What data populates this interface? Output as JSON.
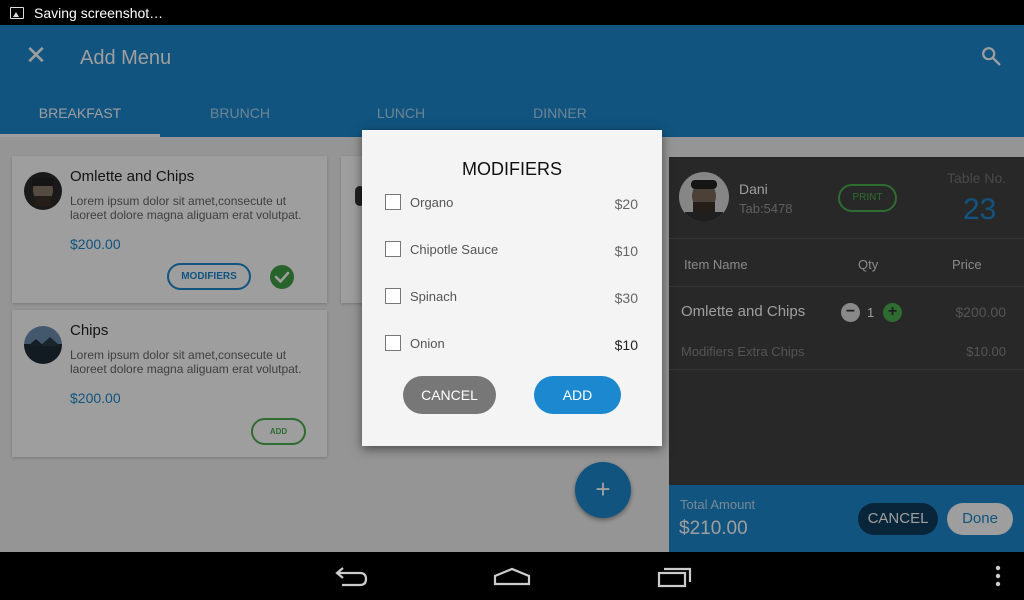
{
  "status_bar": {
    "notification_text": "Saving screenshot…",
    "icon": "image-icon"
  },
  "app_bar": {
    "title": "Add Menu",
    "close_icon": "close-icon",
    "search_icon": "search-icon"
  },
  "tabs": [
    {
      "label": "BREAKFAST",
      "active": true
    },
    {
      "label": "BRUNCH",
      "active": false
    },
    {
      "label": "LUNCH",
      "active": false
    },
    {
      "label": "DINNER",
      "active": false
    }
  ],
  "menu_items": [
    {
      "name": "Omlette and Chips",
      "description": "Lorem ipsum dolor sit amet,consecute ut laoreet dolore magna aliguam erat volutpat.",
      "price": "$200.00",
      "action_label": "MODIFIERS",
      "selected": true
    },
    {
      "name": "Chips",
      "description": "Lorem ipsum dolor sit amet,consecute ut laoreet dolore magna aliguam erat volutpat.",
      "price": "$200.00",
      "action_label": "ADD",
      "selected": false
    }
  ],
  "fab": {
    "label": "+"
  },
  "order_panel": {
    "user_name": "Dani",
    "tab_number": "Tab:5478",
    "print_label": "PRINT",
    "table_label": "Table No.",
    "table_number": "23",
    "headers": {
      "item": "Item Name",
      "qty": "Qty",
      "price": "Price"
    },
    "items": [
      {
        "name": "Omlette and Chips",
        "qty": "1",
        "price": "$200.00"
      }
    ],
    "modifiers": [
      {
        "name": "Modifiers Extra Chips",
        "price": "$10.00"
      }
    ],
    "total_label": "Total Amount",
    "total_value": "$210.00",
    "cancel_label": "CANCEL",
    "done_label": "Done"
  },
  "dialog": {
    "title": "MODIFIERS",
    "options": [
      {
        "label": "Organo",
        "price": "$20",
        "checked": false
      },
      {
        "label": "Chipotle Sauce",
        "price": "$10",
        "checked": false
      },
      {
        "label": "Spinach",
        "price": "$30",
        "checked": false
      },
      {
        "label": "Onion",
        "price": "$10",
        "checked": false
      }
    ],
    "cancel_label": "CANCEL",
    "add_label": "ADD"
  },
  "colors": {
    "primary": "#1c88cf",
    "accent_green": "#4caf50",
    "panel_dark": "#424242"
  },
  "nav_bar": {
    "back_icon": "back-icon",
    "home_icon": "home-icon",
    "recents_icon": "recents-icon",
    "menu_icon": "overflow-menu-icon"
  }
}
